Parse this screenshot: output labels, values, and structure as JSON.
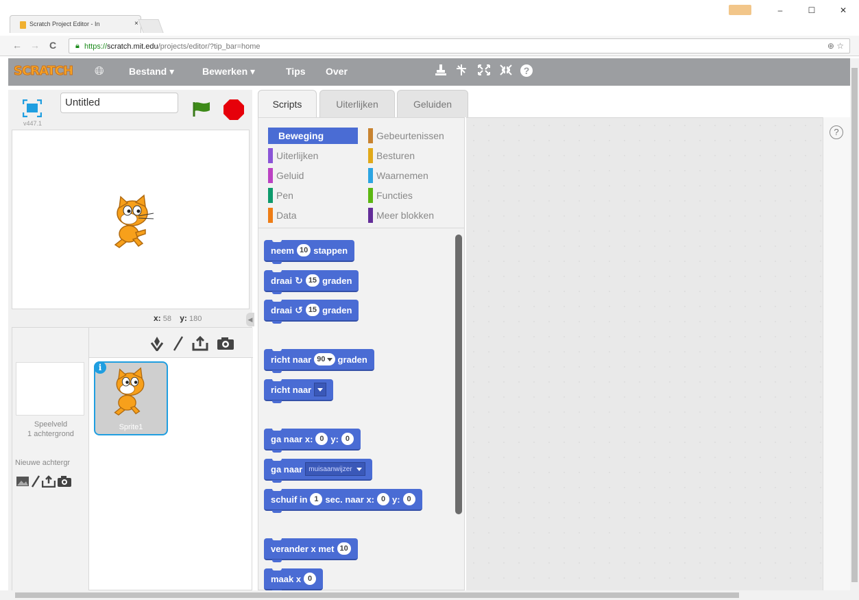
{
  "browser": {
    "tab_title": "Scratch Project Editor - In",
    "tab_close": "×",
    "url_proto": "https://",
    "url_host": "scratch.mit.edu",
    "url_path": "/projects/editor/?tip_bar=home",
    "win_minimize": "–",
    "win_maximize": "☐",
    "win_close": "✕",
    "back": "←",
    "forward": "→",
    "reload": "C",
    "zoom_icon": "⊕",
    "star_icon": "☆",
    "menu_icon": "≡"
  },
  "topbar": {
    "logo": "SCRATCH",
    "menus": [
      "Bestand ▾",
      "Bewerken ▾",
      "Tips",
      "Over"
    ],
    "icons": [
      "stamp-icon",
      "cut-icon",
      "grow-icon",
      "shrink-icon",
      "help-icon"
    ]
  },
  "stage": {
    "version": "v447.1",
    "project_title": "Untitled",
    "x_label": "x:",
    "x_value": "58",
    "y_label": "y:",
    "y_value": "180"
  },
  "sprites": {
    "stage_label": "Speelveld",
    "stage_sub": "1 achtergrond",
    "new_backdrop": "Nieuwe achtergr",
    "sprite_name": "Sprite1",
    "info": "i"
  },
  "editor_tabs": [
    "Scripts",
    "Uiterlijken",
    "Geluiden"
  ],
  "categories": {
    "left": [
      {
        "label": "Beweging",
        "color": "#4a6cd4",
        "active": true
      },
      {
        "label": "Uiterlijken",
        "color": "#8a55d7"
      },
      {
        "label": "Geluid",
        "color": "#bb42c3"
      },
      {
        "label": "Pen",
        "color": "#0e9a6c"
      },
      {
        "label": "Data",
        "color": "#ee7d16"
      }
    ],
    "right": [
      {
        "label": "Gebeurtenissen",
        "color": "#c88330"
      },
      {
        "label": "Besturen",
        "color": "#e1a91a"
      },
      {
        "label": "Waarnemen",
        "color": "#2ca5e2"
      },
      {
        "label": "Functies",
        "color": "#5cb712"
      },
      {
        "label": "Meer blokken",
        "color": "#632d99"
      }
    ]
  },
  "blocks": {
    "b1_a": "neem",
    "b1_n": "10",
    "b1_b": "stappen",
    "b2_a": "draai",
    "b2_n": "15",
    "b2_b": "graden",
    "b3_a": "draai",
    "b3_n": "15",
    "b3_b": "graden",
    "b4_a": "richt naar",
    "b4_n": "90",
    "b4_b": "graden",
    "b5_a": "richt naar",
    "b6_a": "ga naar x:",
    "b6_x": "0",
    "b6_y_label": "y:",
    "b6_y": "0",
    "b7_a": "ga naar",
    "b7_dd": "muisaanwijzer",
    "b8_a": "schuif in",
    "b8_n": "1",
    "b8_b": "sec. naar x:",
    "b8_x": "0",
    "b8_y_label": "y:",
    "b8_y": "0",
    "b9_a": "verander x met",
    "b9_n": "10",
    "b10_a": "maak x",
    "b10_n": "0"
  },
  "help": "?"
}
